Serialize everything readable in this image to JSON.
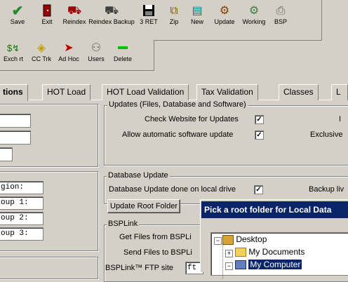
{
  "toolbar": {
    "row1": [
      {
        "label": "Save",
        "icon": "checkmark-icon",
        "color": "#2a8a2a"
      },
      {
        "label": "Exit",
        "icon": "exit-door-icon",
        "color": "#a00000"
      },
      {
        "label": "Reindex",
        "icon": "reindex-icon",
        "color": "#a00000"
      },
      {
        "label": "Reindex Backup",
        "icon": "reindex-backup-icon",
        "color": "#404040"
      },
      {
        "label": "3 RET",
        "icon": "floppy-disk-icon",
        "color": "#000080"
      },
      {
        "label": "Zip",
        "icon": "zip-icon",
        "color": "#806000"
      },
      {
        "label": "New",
        "icon": "new-icon",
        "color": "#008080"
      },
      {
        "label": "Update",
        "icon": "update-icon",
        "color": "#804000"
      },
      {
        "label": "Working",
        "icon": "working-icon",
        "color": "#408040"
      },
      {
        "label": "BSP",
        "icon": "bsp-icon",
        "color": "#606060"
      }
    ],
    "row2": [
      {
        "label": "Exch rt",
        "icon": "exchange-rate-icon",
        "color": "#008000"
      },
      {
        "label": "CC Trk",
        "icon": "cc-track-icon",
        "color": "#c0a000"
      },
      {
        "label": "Ad Hoc",
        "icon": "ad-hoc-icon",
        "color": "#c00000"
      },
      {
        "label": "Users",
        "icon": "users-icon",
        "color": "#606060"
      },
      {
        "label": "Delete",
        "icon": "delete-icon",
        "color": "#00c000"
      }
    ]
  },
  "tabs": [
    "tions",
    "HOT Load",
    "HOT Load Validation",
    "Tax Validation",
    "Classes",
    "L"
  ],
  "left_inputs": [
    "gion:",
    "oup 1:",
    "oup 2:",
    "oup 3:"
  ],
  "updates_group": {
    "title": "Updates (Files, Database and Software)",
    "check_website": "Check Website for Updates",
    "allow_auto": "Allow automatic software update",
    "exclusive": "Exclusive",
    "extra": "I"
  },
  "db_group": {
    "title": "Database Update",
    "local_drive": "Database Update done on local drive",
    "backup": "Backup liv",
    "root_button": "Update Root Folder"
  },
  "bsp_group": {
    "title": "BSPLink",
    "get_files": "Get Files from BSPLi",
    "send_files": "Send Files to BSPLi",
    "ftp_site": "BSPLink™ FTP site",
    "ftp_value": "ft"
  },
  "dialog": {
    "title": "Pick a root folder for Local Data",
    "tree": [
      "Desktop",
      "My Documents",
      "My Computer"
    ]
  },
  "checkmark": "✓"
}
